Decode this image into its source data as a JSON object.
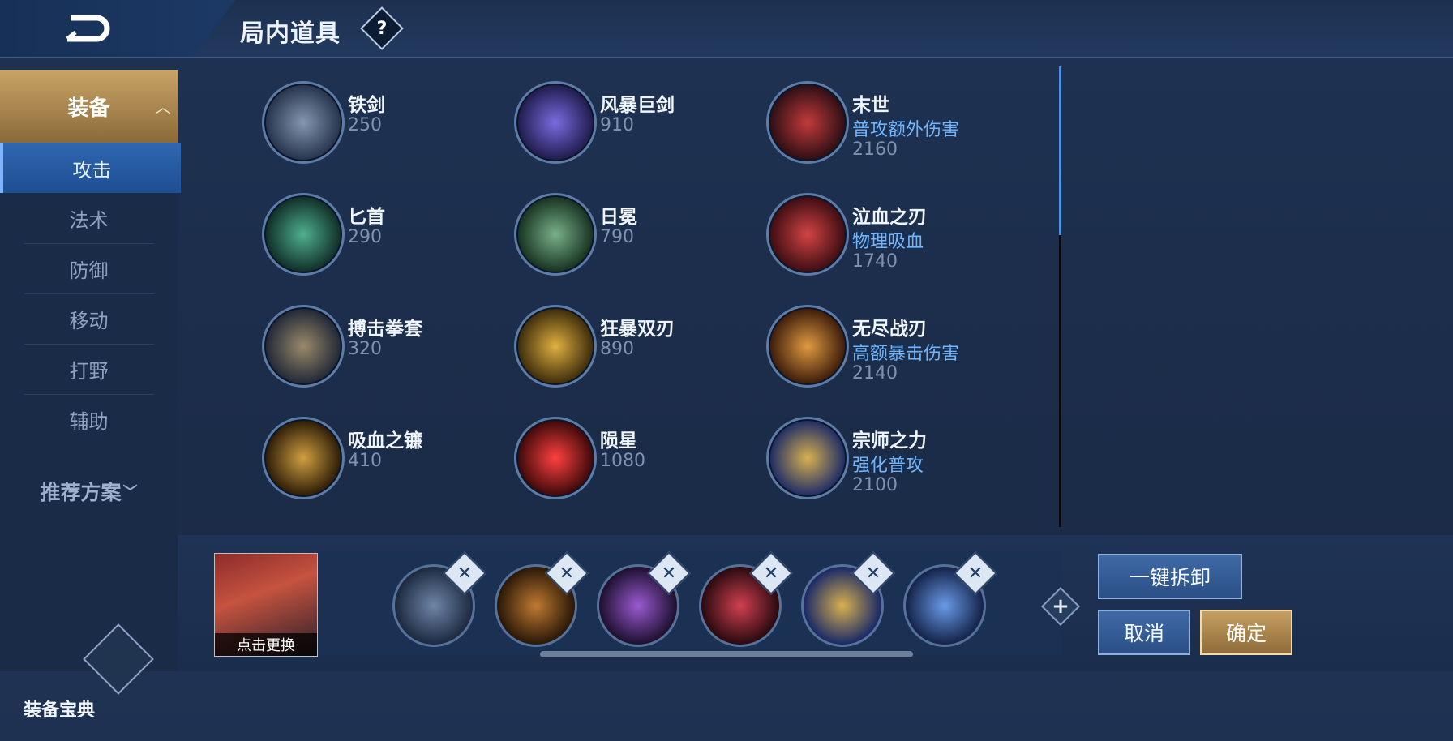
{
  "header": {
    "title": "局内道具",
    "help_symbol": "?"
  },
  "sidebar": {
    "category": "装备",
    "subcategories": [
      "攻击",
      "法术",
      "防御",
      "移动",
      "打野",
      "辅助"
    ],
    "active_subcategory": "攻击",
    "plans_label": "推荐方案",
    "manual_label": "装备宝典"
  },
  "items": [
    {
      "name": "铁剑",
      "desc": "",
      "price": "250",
      "color": "#5a6b84"
    },
    {
      "name": "风暴巨剑",
      "desc": "",
      "price": "910",
      "color": "#4a3b8f"
    },
    {
      "name": "末世",
      "desc": "普攻额外伤害",
      "price": "2160",
      "color": "#7a1d22"
    },
    {
      "name": "匕首",
      "desc": "",
      "price": "290",
      "color": "#1f5a4a"
    },
    {
      "name": "日冕",
      "desc": "",
      "price": "790",
      "color": "#3b6a4e"
    },
    {
      "name": "泣血之刃",
      "desc": "物理吸血",
      "price": "1740",
      "color": "#8a2026"
    },
    {
      "name": "搏击拳套",
      "desc": "",
      "price": "320",
      "color": "#4d5b70"
    },
    {
      "name": "狂暴双刃",
      "desc": "",
      "price": "890",
      "color": "#7a5b1d"
    },
    {
      "name": "无尽战刃",
      "desc": "高额暴击伤害",
      "price": "2140",
      "color": "#7a4a1a"
    },
    {
      "name": "吸血之镰",
      "desc": "",
      "price": "410",
      "color": "#6b4a1a"
    },
    {
      "name": "陨星",
      "desc": "",
      "price": "1080",
      "color": "#8a1a1a"
    },
    {
      "name": "宗师之力",
      "desc": "强化普攻",
      "price": "2100",
      "color": "#2c4a8f"
    }
  ],
  "build": {
    "portrait_action": "点击更换",
    "slots": [
      "blade-icon",
      "boots-icon",
      "purple-blade-icon",
      "red-armor-icon",
      "gold-emblem-icon",
      "trident-icon"
    ],
    "slot_colors": [
      "#2d3d55",
      "#6a4420",
      "#4b2b6e",
      "#6e1f28",
      "#5a4a1e",
      "#2a4a88"
    ],
    "remove_symbol": "✕",
    "add_symbol": "+"
  },
  "buttons": {
    "unequip_all": "一键拆卸",
    "cancel": "取消",
    "confirm": "确定"
  }
}
